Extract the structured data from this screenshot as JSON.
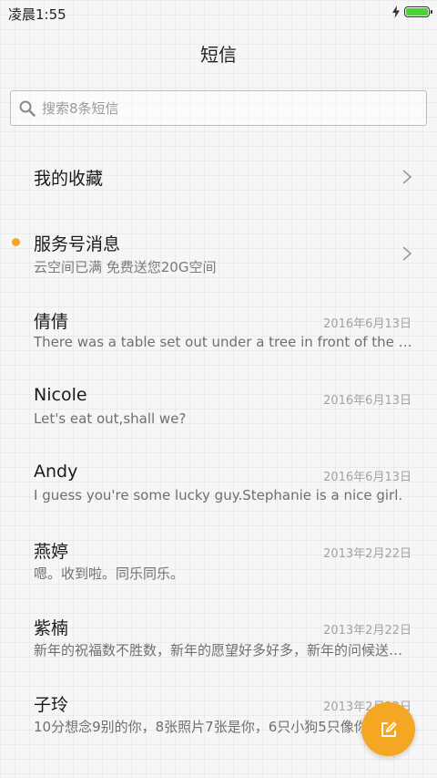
{
  "status_bar": {
    "time": "凌晨1:55",
    "charge_icon": "lightning-icon",
    "battery_icon": "battery-icon",
    "battery_level": 1.0,
    "battery_color": "#4cd137"
  },
  "header": {
    "title": "短信"
  },
  "search": {
    "icon": "search-icon",
    "placeholder": "搜索8条短信",
    "value": ""
  },
  "shortcuts": [
    {
      "title": "我的收藏",
      "icon": "chevron-right-icon"
    },
    {
      "title": "服务号消息",
      "subtitle": "云空间已满 免费送您20G空间",
      "unread": true,
      "icon": "chevron-right-icon"
    }
  ],
  "conversations": [
    {
      "name": "倩倩",
      "date": "2016年6月13日",
      "snippet": "There was a table set out under a tree in front of the house"
    },
    {
      "name": "Nicole",
      "date": "2016年6月13日",
      "snippet": "Let's eat out,shall we?"
    },
    {
      "name": "Andy",
      "date": "2016年6月13日",
      "snippet": "I guess you're some lucky guy.Stephanie is a nice girl."
    },
    {
      "name": "燕婷",
      "date": "2013年2月22日",
      "snippet": "嗯。收到啦。同乐同乐。"
    },
    {
      "name": "紫楠",
      "date": "2013年2月22日",
      "snippet": "新年的祝福数不胜数，新年的愿望好多好多，新年的问候送给你"
    },
    {
      "name": "子玲",
      "date": "2013年2月22日",
      "snippet": "10分想念9别的你，8张照片7张是你，6只小狗5只像你"
    }
  ],
  "fab": {
    "icon": "compose-icon",
    "color": "#f5a623"
  },
  "colors": {
    "accent": "#f5a623",
    "unread_dot": "#f5a623",
    "text_primary": "#1a1a1a",
    "text_secondary": "#7a7a7a",
    "date": "#a3a3a3"
  }
}
